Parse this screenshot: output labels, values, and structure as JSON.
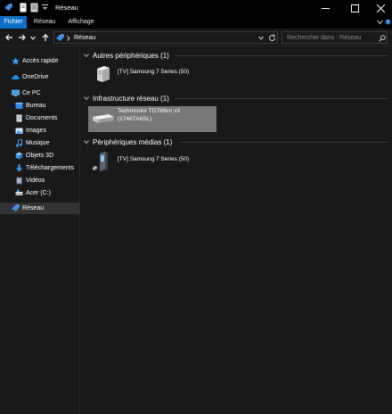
{
  "window": {
    "title": "Réseau"
  },
  "ribbon": {
    "tabs": [
      {
        "label": "Fichier",
        "active": true
      },
      {
        "label": "Réseau",
        "active": false
      },
      {
        "label": "Affichage",
        "active": false
      }
    ]
  },
  "address": {
    "location": "Réseau",
    "search_placeholder": "Rechercher dans : Réseau"
  },
  "nav": {
    "items": [
      {
        "label": "Accès rapide",
        "icon": "star-icon"
      },
      {
        "label": "OneDrive",
        "icon": "cloud-icon"
      },
      {
        "label": "Ce PC",
        "icon": "computer-icon"
      },
      {
        "label": "Bureau",
        "icon": "desktop-icon"
      },
      {
        "label": "Documents",
        "icon": "documents-icon"
      },
      {
        "label": "Images",
        "icon": "pictures-icon"
      },
      {
        "label": "Musique",
        "icon": "music-icon"
      },
      {
        "label": "Objets 3D",
        "icon": "cube-icon"
      },
      {
        "label": "Téléchargements",
        "icon": "download-icon"
      },
      {
        "label": "Vidéos",
        "icon": "video-icon"
      },
      {
        "label": "Acer (C:)",
        "icon": "drive-icon"
      },
      {
        "label": "Réseau",
        "icon": "network-icon",
        "selected": true
      }
    ]
  },
  "groups": [
    {
      "title": "Autres périphériques (1)",
      "items": [
        {
          "name": "[TV] Samsung 7 Series (50)",
          "icon": "tv-device-icon"
        }
      ]
    },
    {
      "title": "Infrastructure réseau (1)",
      "items": [
        {
          "name": "Technicolor TG789vn v3",
          "subname": "(1746TA6SL)",
          "icon": "router-icon",
          "selected": true
        }
      ]
    },
    {
      "title": "Périphériques médias (1)",
      "items": [
        {
          "name": "[TV] Samsung 7 Series (50)",
          "icon": "media-device-icon"
        }
      ]
    }
  ],
  "colors": {
    "accent": "#0f6fc6",
    "background": "#191919",
    "titlebar": "#000000",
    "selection": "#777777",
    "nav_selection": "#333333"
  }
}
